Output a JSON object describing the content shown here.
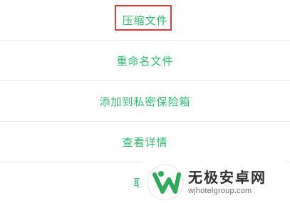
{
  "menu": {
    "items": [
      {
        "label": "压缩文件"
      },
      {
        "label": "重命名文件"
      },
      {
        "label": "添加到私密保险箱"
      },
      {
        "label": "查看详情"
      },
      {
        "label": "取消"
      }
    ]
  },
  "watermark": {
    "title": "无极安卓网",
    "url": "wjhotelgroup.com"
  },
  "colors": {
    "item_text": "#2bbd6e",
    "highlight_border": "#e53935",
    "divider": "#ececec"
  }
}
